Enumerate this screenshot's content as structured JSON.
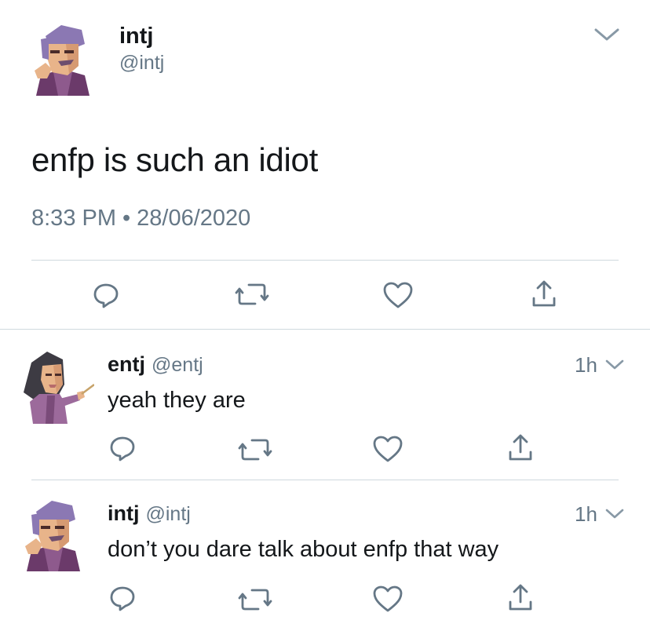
{
  "main_tweet": {
    "name": "intj",
    "handle": "@intj",
    "text": "enfp is such an idiot",
    "time": "8:33 PM",
    "separator": "•",
    "date": "28/06/2020"
  },
  "replies": [
    {
      "name": "entj",
      "handle": "@entj",
      "time": "1h",
      "text": "yeah they are"
    },
    {
      "name": "intj",
      "handle": "@intj",
      "time": "1h",
      "text": "don’t you dare talk about enfp that way"
    }
  ],
  "colors": {
    "icon_gray": "#657786",
    "divider": "#cfd9de",
    "text": "#14171a"
  },
  "icons": [
    "caret-down-icon",
    "reply-icon",
    "retweet-icon",
    "like-icon",
    "share-icon"
  ]
}
